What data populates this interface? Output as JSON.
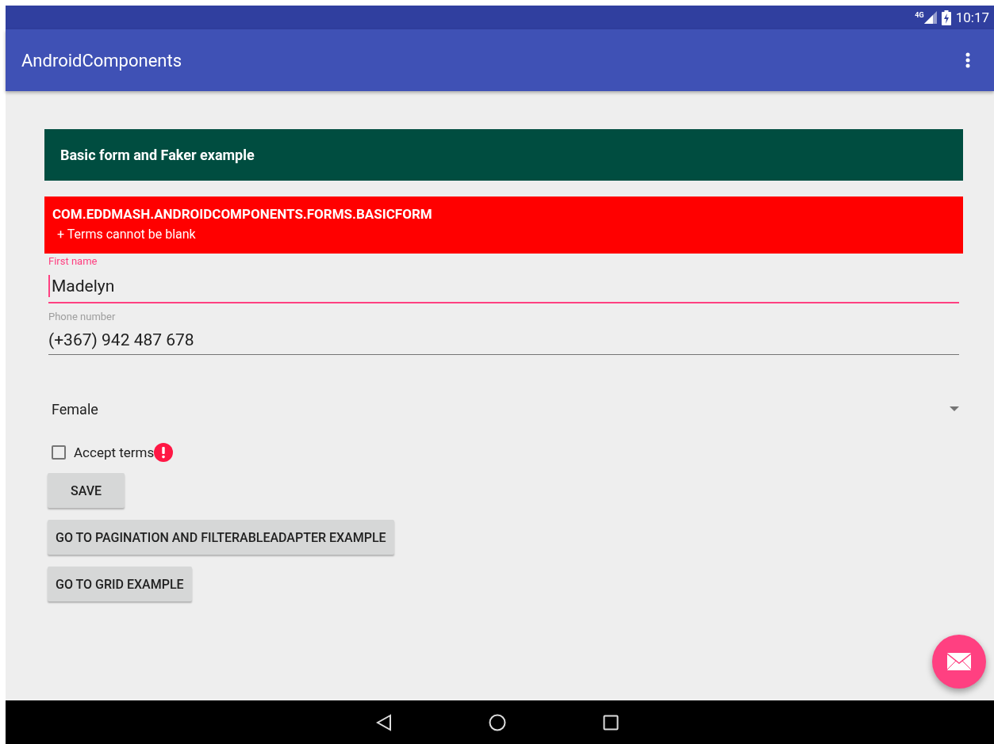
{
  "status_bar": {
    "network": "4G",
    "time": "10:17"
  },
  "app_bar": {
    "title": "AndroidComponents"
  },
  "banner": {
    "title": "Basic form and Faker example"
  },
  "error_box": {
    "title": "COM.EDDMASH.ANDROIDCOMPONENTS.FORMS.BASICFORM",
    "messages": [
      "+ Terms cannot be blank"
    ]
  },
  "fields": [
    {
      "label": "First name",
      "value": "Madelyn",
      "focused": true
    },
    {
      "label": "Phone number",
      "value": "(+367) 942 487 678",
      "focused": false
    }
  ],
  "spinner": {
    "value": "Female"
  },
  "checkbox": {
    "label": "Accept terms",
    "checked": false,
    "error": true
  },
  "buttons": [
    "SAVE",
    "GO TO PAGINATION AND FILTERABLEADAPTER EXAMPLE",
    "GO TO GRID EXAMPLE"
  ]
}
